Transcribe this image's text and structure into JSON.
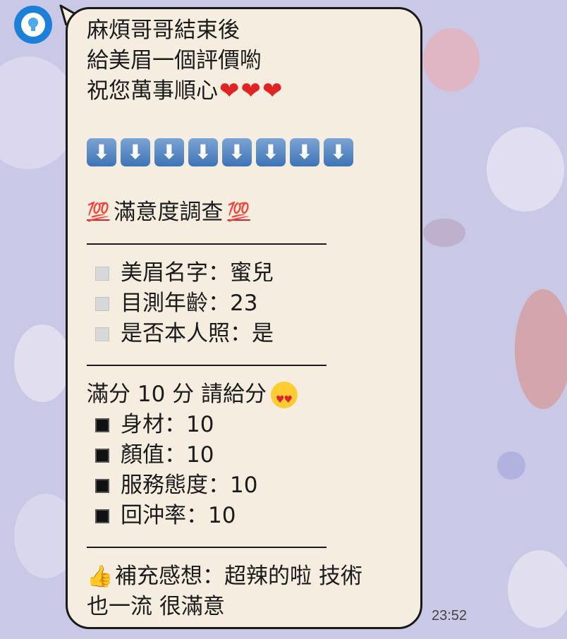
{
  "message": {
    "lines": [
      "麻煩哥哥結束後",
      "給美眉一個評價喲",
      "祝您萬事順心"
    ],
    "hearts": [
      "❤",
      "❤",
      "❤"
    ],
    "arrow_glyph": "⬇",
    "survey_title": "滿意度調查",
    "hundred_icon": "💯",
    "info_items": [
      "美眉名字：蜜兒",
      "目測年齡：23",
      "是否本人照：是"
    ],
    "score_prompt": "滿分 10 分 請給分",
    "scores": [
      "身材：10",
      "顏值：10",
      "服務態度：10",
      "回沖率：10"
    ],
    "comment_line1": "補充感想：超辣的啦 技術",
    "comment_line2": "也一流 很滿意"
  },
  "timestamp": "23:52",
  "colors": {
    "background": "#c9c8e6",
    "bubble": "#f6ede1",
    "avatar": "#1e7fd8"
  }
}
